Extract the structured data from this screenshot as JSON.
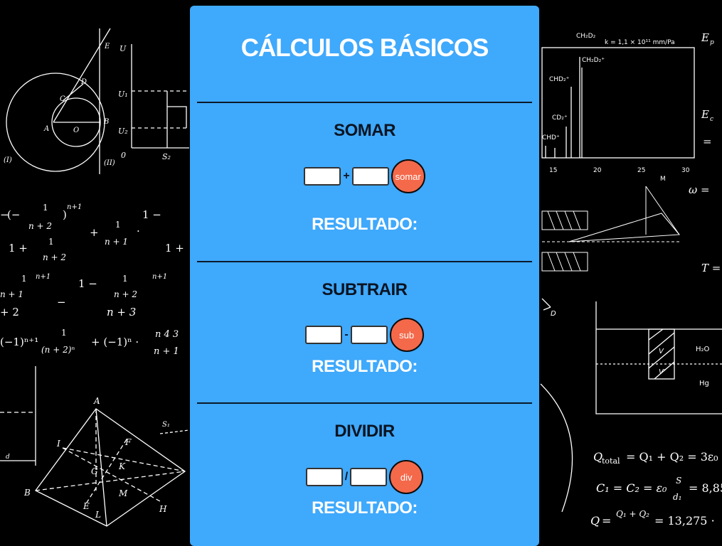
{
  "title": "CÁLCULOS BÁSICOS",
  "sections": [
    {
      "heading": "SOMAR",
      "operator": "+",
      "button": "somar",
      "result_label": "RESULTADO:"
    },
    {
      "heading": "SUBTRAIR",
      "operator": "-",
      "button": "sub",
      "result_label": "RESULTADO:"
    },
    {
      "heading": "DIVIDIR",
      "operator": "/",
      "button": "div",
      "result_label": "RESULTADO:"
    }
  ],
  "background": {
    "formulas": {
      "charge": "Q",
      "q_total": "total",
      "q_total_rhs": "= Q₁ + Q₂ = 3ε₀",
      "capacitance": "C₁ = C₂ = ε₀",
      "cap_s": "S",
      "cap_d": "d₁",
      "cap_val": "= 8,85",
      "q_rhs": "=",
      "q_frac_num": "Q₁ + Q₂",
      "q_val": "= 13,275 ·",
      "omega": "ω = ",
      "ep": "E",
      "ep_sub": "p",
      "ec": "E",
      "ec_sub": "c",
      "eq": "=",
      "t": "T =",
      "series_1": "(−1)ⁿ⁺¹",
      "series_2": "+ (−1)ⁿ ·",
      "frac_1_n2": "n + 2",
      "frac_1_n1": "n + 1",
      "frac_1_n3": "n + 3",
      "frac_n43": "n 4 3",
      "frac_n1": "n + 1",
      "frac_n22": "(n + 2)ⁿ",
      "one": "1",
      "one_plus": "1 +",
      "plus": "+",
      "dot": "·",
      "one_minus": "1 −",
      "exp": "n+1",
      "two": "+ 2",
      "minus": "−",
      "lbrack_neg": "(−",
      "rparen": ")",
      "s1": "S₁"
    },
    "spectrum": {
      "peak_label_1": "CH₂D₂",
      "k_label": "k = 1,1 × 10¹¹ mm/Pa",
      "peak_label_2": "CH₂D₂⁺",
      "peak_label_3": "CHD₂⁺",
      "peak_label_4": "CD₂⁺",
      "peak_label_5": "CHD⁺",
      "ticks": [
        "15",
        "20",
        "25",
        "30"
      ],
      "axis_label": "M"
    },
    "geometry": {
      "labels": [
        "E",
        "D",
        "C",
        "A",
        "O",
        "B",
        "(I)",
        "(II)"
      ],
      "u": "U",
      "u1": "U₁",
      "u2": "U₂",
      "zero": "0",
      "s2": "S₂"
    },
    "pyramid": {
      "labels": [
        "A",
        "I",
        "F",
        "G",
        "K",
        "B",
        "M",
        "E",
        "L",
        "H"
      ],
      "d": "d"
    },
    "tank": {
      "water": "H₂O",
      "mercury": "Hg",
      "v1": "V",
      "v2": "V'",
      "d": "D"
    }
  }
}
